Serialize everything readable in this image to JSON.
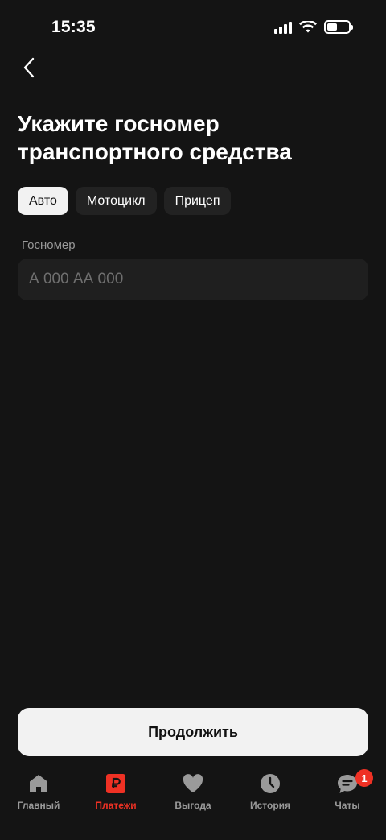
{
  "status_bar": {
    "time": "15:35"
  },
  "page": {
    "title": "Укажите госномер транспортного средства"
  },
  "tabs": [
    {
      "label": "Авто",
      "selected": true
    },
    {
      "label": "Мотоцикл",
      "selected": false
    },
    {
      "label": "Прицеп",
      "selected": false
    }
  ],
  "field": {
    "label": "Госномер",
    "placeholder": "А 000 АА 000",
    "value": ""
  },
  "actions": {
    "continue_label": "Продолжить"
  },
  "bottom_nav": {
    "items": [
      {
        "label": "Главный",
        "icon": "home-icon"
      },
      {
        "label": "Платежи",
        "icon": "ruble-icon",
        "active": true
      },
      {
        "label": "Выгода",
        "icon": "heart-icon"
      },
      {
        "label": "История",
        "icon": "clock-icon"
      },
      {
        "label": "Чаты",
        "icon": "chat-icon",
        "badge": "1"
      }
    ]
  },
  "colors": {
    "background": "#141414",
    "accent": "#ef3124",
    "inactive": "#9a9a9a"
  }
}
